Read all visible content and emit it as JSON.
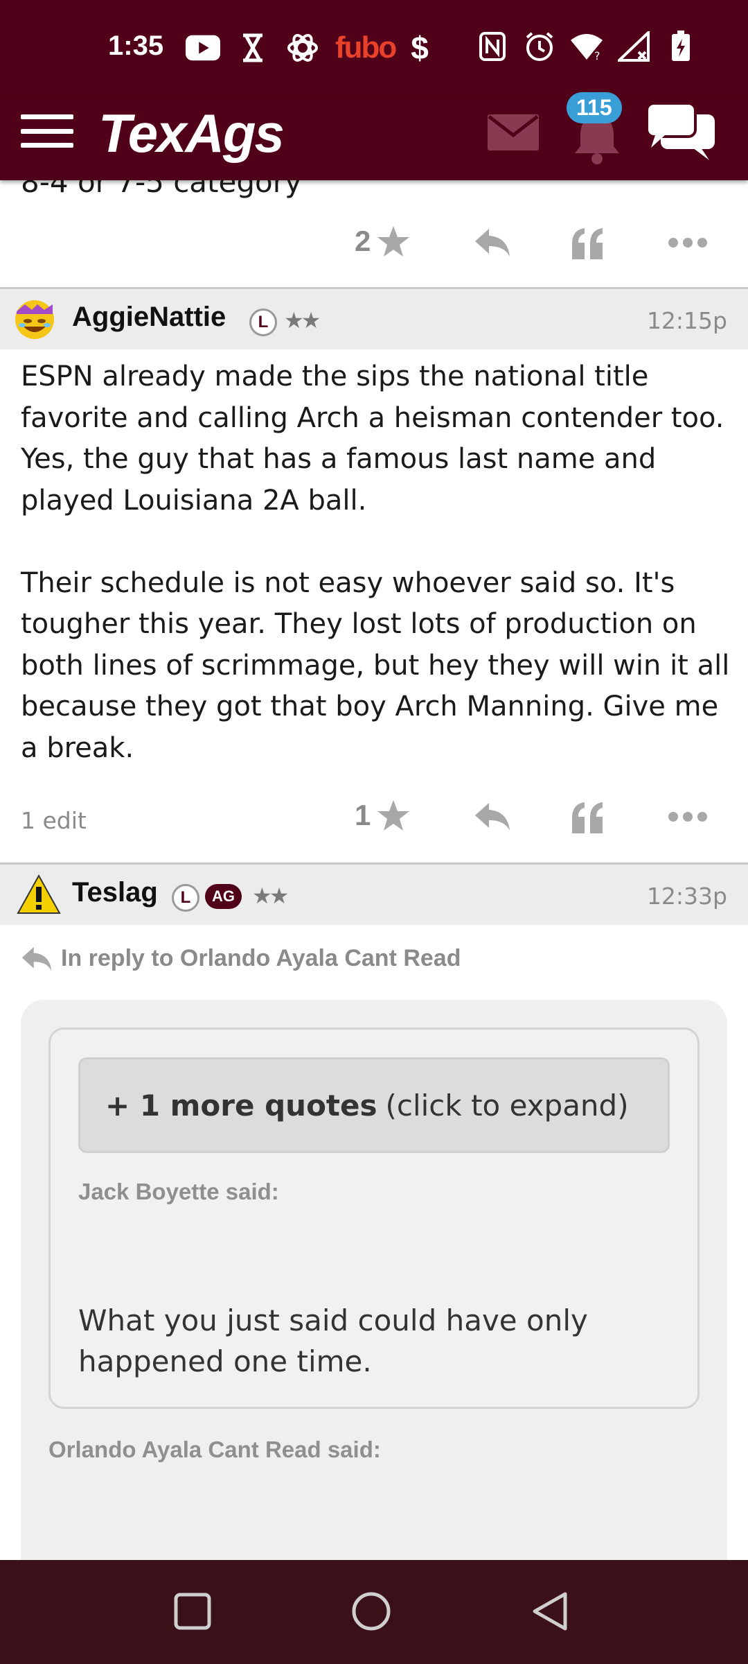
{
  "status_bar": {
    "time": "1:35",
    "left_icons": [
      "youtube-icon",
      "hourglass-icon",
      "openai-icon",
      "fubo-icon",
      "dollar-icon"
    ],
    "fubo_text": "fubo",
    "dollar_text": "$",
    "right_icons": [
      "nfc-icon",
      "alarm-icon",
      "wifi-icon",
      "signal-icon",
      "battery-charging-icon"
    ],
    "background": "#500018"
  },
  "header": {
    "logo": "TexAgs",
    "notification_count": "115",
    "badge_color": "#3a9fd6",
    "icons": [
      "menu-icon",
      "mail-icon",
      "bell-icon",
      "chat-icon"
    ]
  },
  "previous_post": {
    "partial_text": "8-4 or 7-5 category",
    "star_count": "2"
  },
  "posts": [
    {
      "username": "AggieNattie",
      "badges": [
        "L"
      ],
      "stars": "★★",
      "time": "12:15p",
      "paragraphs": [
        "ESPN already made the sips the national title favorite and calling Arch a heisman contender too. Yes, the guy that has a famous last name and played Louisiana 2A ball.",
        "Their schedule is not easy whoever said so. It's tougher this year. They lost lots of production on both lines of scrimmage, but hey they will win it all because they got that boy Arch Manning. Give me a break."
      ],
      "edit_note": "1 edit",
      "star_count": "1"
    },
    {
      "username": "Teslag",
      "badges": [
        "L",
        "AG"
      ],
      "stars": "★★",
      "time": "12:33p",
      "reply_to": "In reply to Orlando Ayala Cant Read",
      "more_quotes_bold": "+ 1 more quotes",
      "more_quotes_rest": "(click to expand)",
      "quote_author_1": "Jack Boyette said:",
      "quote_text_1": "What you just said could have only happened one time.",
      "quote_author_2": "Orlando Ayala Cant Read said:"
    }
  ],
  "nav": [
    "recents-icon",
    "home-icon",
    "back-icon"
  ]
}
